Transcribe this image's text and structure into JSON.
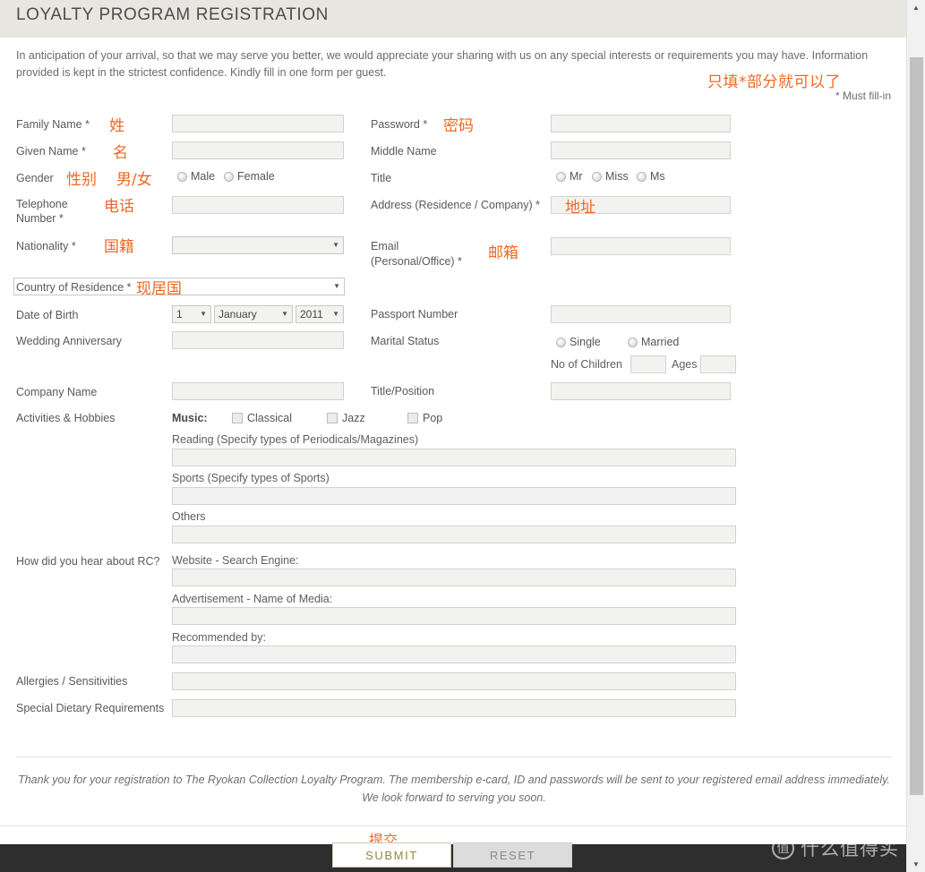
{
  "header": {
    "title": "LOYALTY PROGRAM REGISTRATION",
    "accent_color": "#ef6820",
    "band_color": "#e8e6e0"
  },
  "intro": {
    "text": "In anticipation of your arrival, so that we may serve you better, we would appreciate your sharing with us on any special interests or requirements you may have. Information provided is kept in the strictest confidence. Kindly fill in one form per guest."
  },
  "annotations": {
    "top_note": "只填*部分就可以了",
    "must_fill": "* Must fill-in",
    "family_name": "姓",
    "given_name": "名",
    "gender": "性别",
    "gender_options": "男/女",
    "telephone": "电话",
    "nationality": "国籍",
    "country_of_residence": "现居国",
    "password": "密码",
    "address": "地址",
    "email": "邮箱",
    "submit": "提交"
  },
  "left_column": {
    "family_name_label": "Family Name *",
    "family_name_value": "",
    "given_name_label": "Given Name *",
    "given_name_value": "",
    "gender_label": "Gender",
    "gender_options": [
      "Male",
      "Female"
    ],
    "telephone_label": "Telephone Number *",
    "telephone_value": "",
    "nationality_label": "Nationality *",
    "nationality_value": "",
    "country_label": "Country of Residence *",
    "country_value": "",
    "dob_label": "Date of Birth",
    "dob_day": "1",
    "dob_month": "January",
    "dob_year": "2011",
    "wedding_label": "Wedding Anniversary",
    "wedding_value": "",
    "company_label": "Company Name",
    "company_value": "",
    "activities_label": "Activities & Hobbies",
    "hear_about_label": "How did you hear about RC?",
    "allergies_label": "Allergies / Sensitivities",
    "allergies_value": "",
    "dietary_label": "Special Dietary Requirements",
    "dietary_value": ""
  },
  "right_column": {
    "password_label": "Password *",
    "password_value": "",
    "middle_name_label": "Middle Name",
    "middle_name_value": "",
    "title_label": "Title",
    "title_options": [
      "Mr",
      "Miss",
      "Ms"
    ],
    "address_label": "Address (Residence / Company) *",
    "address_value": "",
    "email_label": "Email (Personal/Office) *",
    "email_label_line1": "Email",
    "email_label_line2": "(Personal/Office) *",
    "email_value": "",
    "passport_label": "Passport Number",
    "passport_value": "",
    "marital_label": "Marital Status",
    "marital_options": [
      "Single",
      "Married"
    ],
    "children_label": "No of Children",
    "children_value": "",
    "ages_label": "Ages",
    "ages_value": "",
    "title_position_label": "Title/Position",
    "title_position_value": ""
  },
  "hobbies": {
    "music_label": "Music:",
    "music_options": [
      "Classical",
      "Jazz",
      "Pop"
    ],
    "reading_label": "Reading (Specify types of Periodicals/Magazines)",
    "reading_value": "",
    "sports_label": "Sports (Specify types of Sports)",
    "sports_value": "",
    "others_label": "Others",
    "others_value": ""
  },
  "referral": {
    "website_label": "Website - Search Engine:",
    "website_value": "",
    "advertisement_label": "Advertisement - Name of Media:",
    "advertisement_value": "",
    "recommended_label": "Recommended by:",
    "recommended_value": ""
  },
  "footer": {
    "thankyou": "Thank you for your registration to The Ryokan Collection Loyalty Program. The membership e-card, ID and passwords will be sent to your registered email address immediately. We look forward to serving you soon.",
    "submit_label": "SUBMIT",
    "reset_label": "RESET",
    "watermark_logo": "值",
    "watermark_text": "什么值得买"
  },
  "scrollbar": {
    "up_arrow": "▲",
    "down_arrow": "▼"
  }
}
